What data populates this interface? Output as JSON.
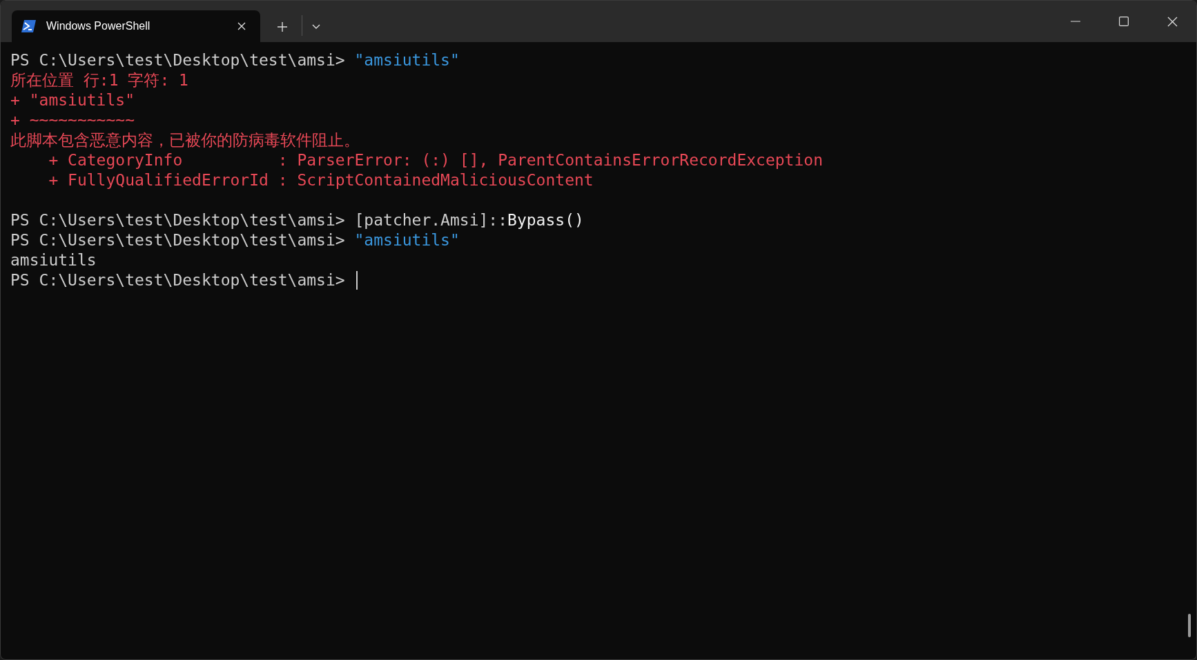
{
  "window": {
    "tabs": [
      {
        "title": "Windows PowerShell",
        "selected": true
      }
    ]
  },
  "terminal": {
    "blocks": [
      {
        "lines": [
          {
            "segments": [
              {
                "kind": "prompt",
                "text": "PS C:\\Users\\test\\Desktop\\test\\amsi> "
              },
              {
                "kind": "string",
                "text": "\"amsiutils\""
              }
            ]
          },
          {
            "segments": [
              {
                "kind": "error",
                "text": "所在位置 行:1 字符: 1"
              }
            ]
          },
          {
            "segments": [
              {
                "kind": "error",
                "text": "+ \"amsiutils\""
              }
            ]
          },
          {
            "segments": [
              {
                "kind": "error",
                "text": "+ ~~~~~~~~~~~"
              }
            ]
          },
          {
            "segments": [
              {
                "kind": "error",
                "text": "此脚本包含恶意内容，已被你的防病毒软件阻止。"
              }
            ]
          },
          {
            "segments": [
              {
                "kind": "error",
                "text": "    + CategoryInfo          : ParserError: (:) [], ParentContainsErrorRecordException"
              }
            ]
          },
          {
            "segments": [
              {
                "kind": "error",
                "text": "    + FullyQualifiedErrorId : ScriptContainedMaliciousContent"
              }
            ]
          }
        ]
      },
      {
        "lines": [
          {
            "segments": [
              {
                "kind": "prompt",
                "text": "PS C:\\Users\\test\\Desktop\\test\\amsi> "
              },
              {
                "kind": "prompt",
                "text": "[patcher.Amsi]::"
              },
              {
                "kind": "command",
                "text": "Bypass()"
              }
            ]
          },
          {
            "segments": [
              {
                "kind": "prompt",
                "text": "PS C:\\Users\\test\\Desktop\\test\\amsi> "
              },
              {
                "kind": "string",
                "text": "\"amsiutils\""
              }
            ]
          },
          {
            "segments": [
              {
                "kind": "output",
                "text": "amsiutils"
              }
            ]
          },
          {
            "segments": [
              {
                "kind": "prompt",
                "text": "PS C:\\Users\\test\\Desktop\\test\\amsi> "
              }
            ],
            "cursor": true
          }
        ]
      }
    ]
  }
}
